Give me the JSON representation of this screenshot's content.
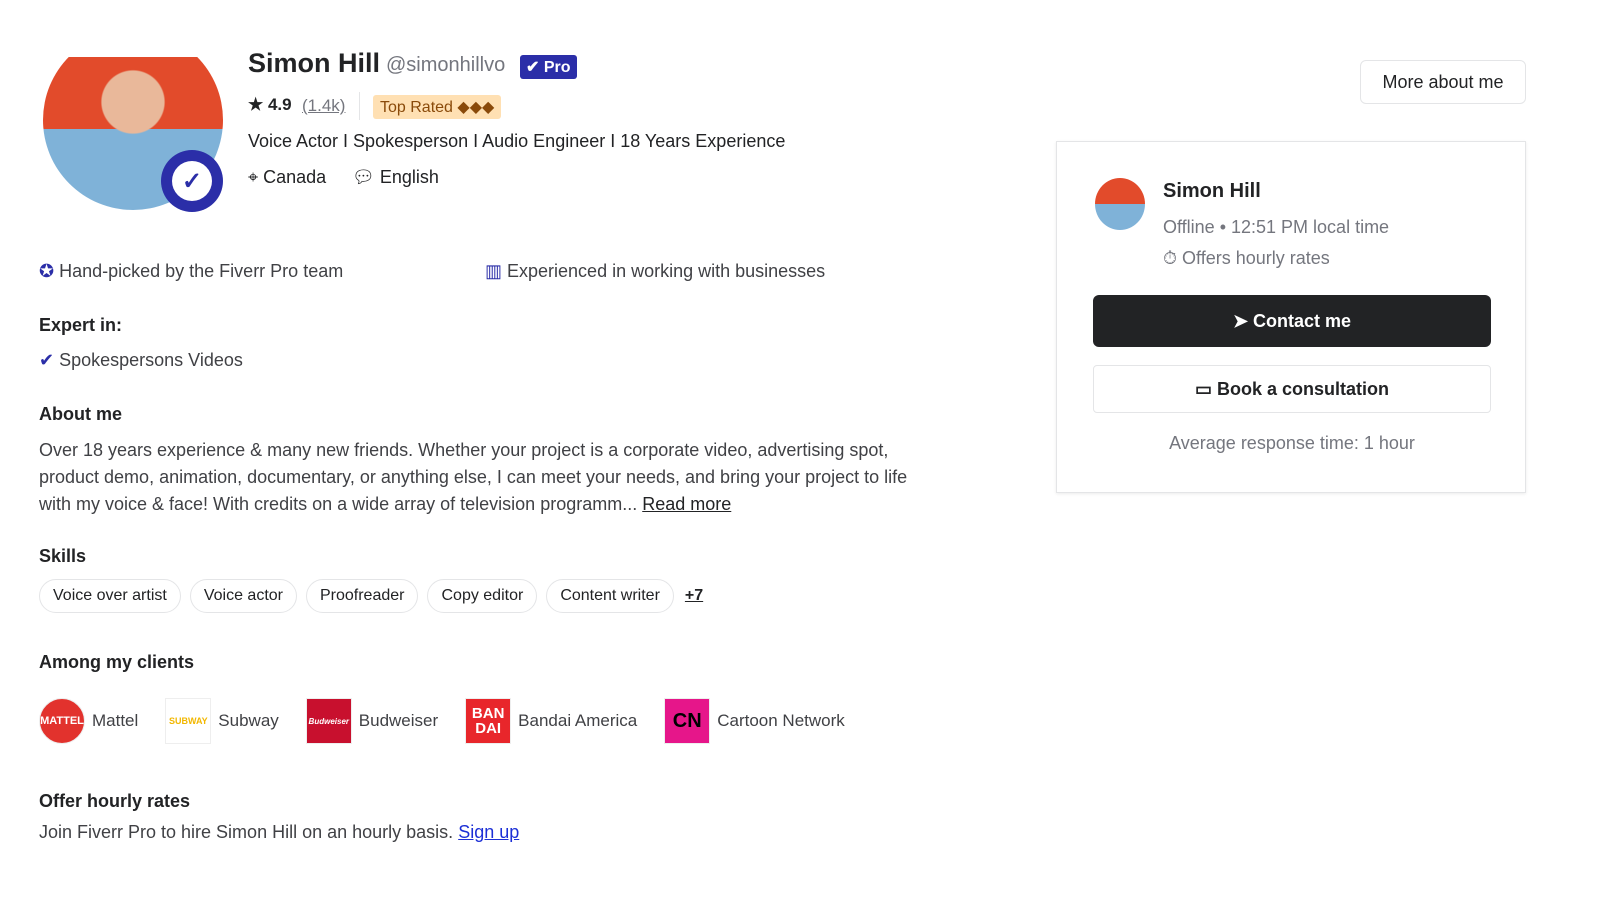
{
  "profile": {
    "name": "Simon Hill",
    "handle": "@simonhillvo",
    "pro_label": "Pro",
    "rating": "4.9",
    "reviews": "(1.4k)",
    "top_rated": "Top Rated ◆◆◆",
    "tagline": "Voice Actor I Spokesperson I Audio Engineer I 18 Years Experience",
    "country": "Canada",
    "language": "English"
  },
  "highlights": [
    "Hand-picked by the Fiverr Pro team",
    "Experienced in working with businesses"
  ],
  "expert": {
    "heading": "Expert in:",
    "item": "Spokespersons Videos"
  },
  "about": {
    "heading": "About me",
    "text": "Over 18 years experience & many new friends. Whether your project is a corporate video, advertising spot, product demo, animation, documentary, or anything else, I can meet your needs, and bring your project to life with my voice & face!   With credits on a wide array of television programm...",
    "read_more": "Read more"
  },
  "skills": {
    "heading": "Skills",
    "items": [
      "Voice over artist",
      "Voice actor",
      "Proofreader",
      "Copy editor",
      "Content writer"
    ],
    "more": "+7"
  },
  "clients": {
    "heading": "Among my clients",
    "items": [
      {
        "name": "Mattel",
        "logo": "MATTEL",
        "color": "#e2322d"
      },
      {
        "name": "Subway",
        "logo": "SUBWAY",
        "color": "#ffffff"
      },
      {
        "name": "Budweiser",
        "logo": "Budweiser",
        "color": "#c8102e"
      },
      {
        "name": "Bandai America",
        "logo": "BAN DAI",
        "color": "#e8262b"
      },
      {
        "name": "Cartoon Network",
        "logo": "CN",
        "color": "#e6168a"
      }
    ]
  },
  "hourly": {
    "heading": "Offer hourly rates",
    "text": "Join Fiverr Pro to hire Simon Hill on an hourly basis.",
    "link": "Sign up"
  },
  "side": {
    "more_about": "More about me",
    "name": "Simon Hill",
    "status": "Offline • 12:51 PM local time",
    "hourly": "Offers hourly rates",
    "contact": "Contact me",
    "book": "Book a consultation",
    "response": "Average response time: 1 hour"
  }
}
